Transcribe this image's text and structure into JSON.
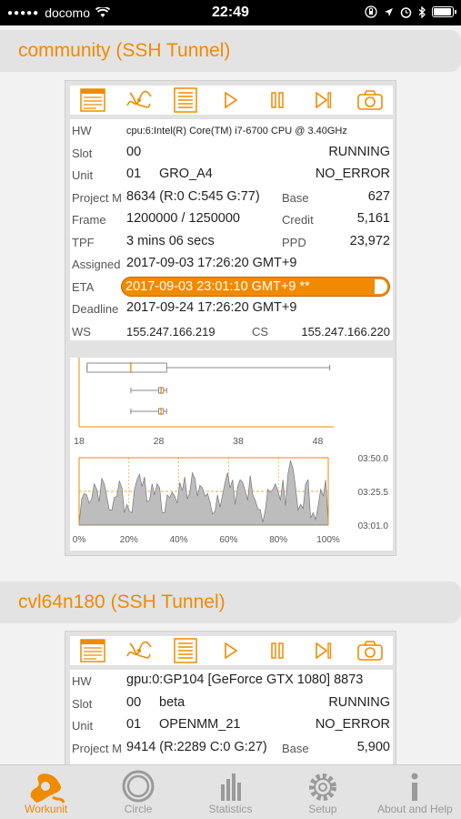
{
  "status_bar": {
    "carrier": "docomo",
    "signal": "●●●●●",
    "time": "22:49"
  },
  "slots": [
    {
      "title": "community (SSH Tunnel)",
      "rows": {
        "hw_label": "HW",
        "hw": "cpu:6:Intel(R) Core(TM) i7-6700 CPU @ 3.40GHz",
        "slot_label": "Slot",
        "slot": "00",
        "slot_status": "RUNNING",
        "unit_label": "Unit",
        "unit_num": "01",
        "unit_core": "GRO_A4",
        "unit_status": "NO_ERROR",
        "project_label": "Project M",
        "project": "8634 (R:0 C:545 G:77)",
        "base_label": "Base",
        "base": "627",
        "frame_label": "Frame",
        "frame": "1200000 / 1250000",
        "credit_label": "Credit",
        "credit": "5,161",
        "tpf_label": "TPF",
        "tpf": "3 mins 06 secs",
        "ppd_label": "PPD",
        "ppd": "23,972",
        "assigned_label": "Assigned",
        "assigned": "2017-09-03 17:26:20 GMT+9",
        "eta_label": "ETA",
        "eta": "2017-09-03 23:01:10 GMT+9 **",
        "deadline_label": "Deadline",
        "deadline": "2017-09-24 17:26:20 GMT+9",
        "ws_label": "WS",
        "ws": "155.247.166.219",
        "cs_label": "CS",
        "cs": "155.247.166.220"
      }
    },
    {
      "title": "cvl64n180 (SSH Tunnel)",
      "rows": {
        "hw_label": "HW",
        "hw": "gpu:0:GP104 [GeForce GTX 1080] 8873",
        "slot_label": "Slot",
        "slot": "00",
        "slot_extra": "beta",
        "slot_status": "RUNNING",
        "unit_label": "Unit",
        "unit_num": "01",
        "unit_core": "OPENMM_21",
        "unit_status": "NO_ERROR",
        "project_label": "Project M",
        "project": "9414 (R:2289 C:0 G:27)",
        "base_label": "Base",
        "base": "5,900"
      }
    }
  ],
  "chart_data": [
    {
      "type": "box",
      "x_ticks": [
        "18",
        "28",
        "38",
        "48"
      ],
      "xlim": [
        18,
        50
      ],
      "boxes": [
        {
          "min": 19,
          "q1": 19,
          "median": 24.5,
          "q3": 29,
          "max": 49.5
        },
        {
          "min": 24.5,
          "q1": 28,
          "median": 28.3,
          "q3": 28.6,
          "max": 29
        },
        {
          "min": 24.5,
          "q1": 28,
          "median": 28.3,
          "q3": 28.6,
          "max": 29
        }
      ]
    },
    {
      "type": "area",
      "x_ticks": [
        "0%",
        "20%",
        "40%",
        "60%",
        "80%",
        "100%"
      ],
      "y_ticks": [
        "03:50.0",
        "03:25.5",
        "03:01.0"
      ],
      "ylim_seconds": [
        181,
        230
      ],
      "values_seconds": [
        182,
        200,
        204,
        203,
        197,
        200,
        211,
        207,
        198,
        215,
        211,
        202,
        192,
        192,
        201,
        202,
        213,
        208,
        190,
        196,
        191,
        190,
        207,
        214,
        218,
        209,
        216,
        198,
        199,
        211,
        203,
        211,
        208,
        190,
        190,
        203,
        201,
        205,
        202,
        197,
        212,
        206,
        216,
        200,
        205,
        219,
        215,
        202,
        210,
        208,
        202,
        204,
        198,
        189,
        191,
        203,
        194,
        203,
        212,
        219,
        208,
        214,
        196,
        209,
        214,
        212,
        206,
        199,
        217,
        203,
        199,
        193,
        192,
        183,
        192,
        207,
        205,
        207,
        211,
        206,
        199,
        214,
        195,
        218,
        228,
        222,
        209,
        192,
        196,
        193,
        211,
        214,
        186,
        190,
        185,
        195,
        207,
        202,
        214,
        183
      ]
    }
  ],
  "tabs": [
    {
      "label": "Workunit",
      "active": true
    },
    {
      "label": "Circle",
      "active": false
    },
    {
      "label": "Statistics",
      "active": false
    },
    {
      "label": "Setup",
      "active": false
    },
    {
      "label": "About and Help",
      "active": false
    }
  ],
  "colors": {
    "accent": "#f08a00",
    "header_bg": "#e3e3e3",
    "panel_bg": "#e2e2e2"
  }
}
